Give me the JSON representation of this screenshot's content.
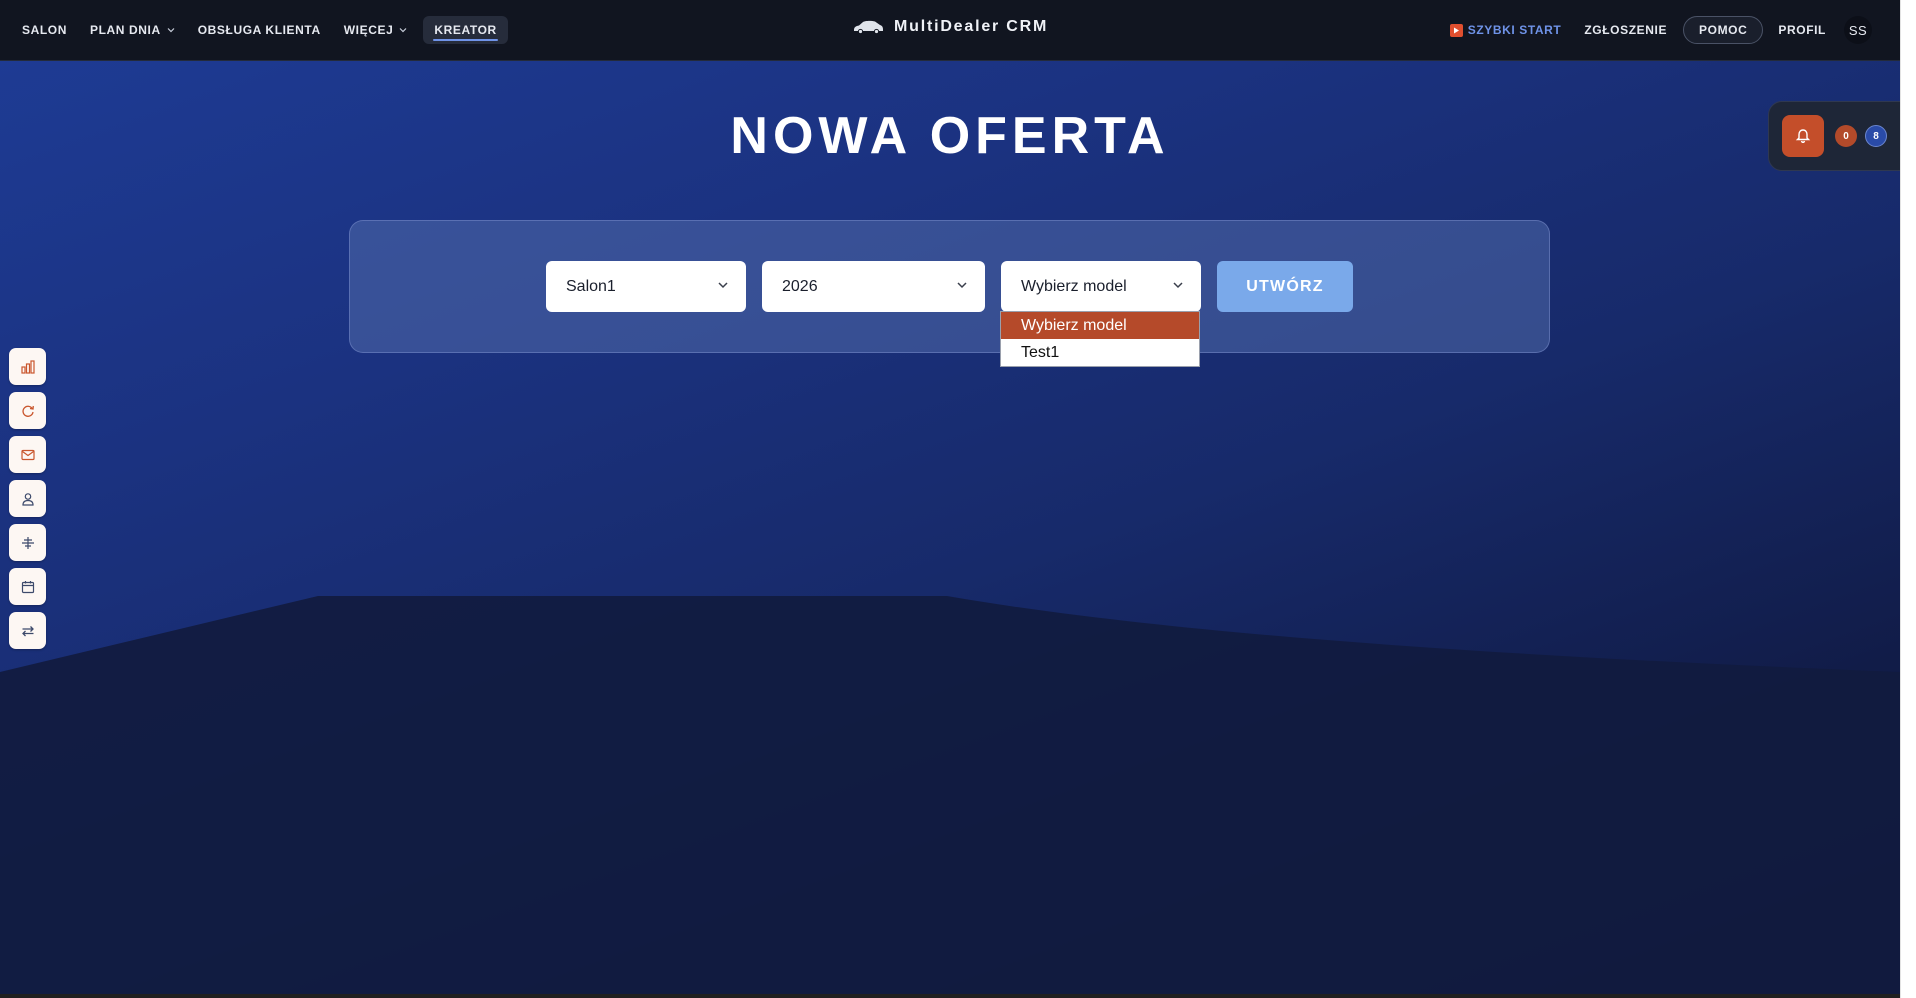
{
  "nav": {
    "left_items": [
      "SALON",
      "PLAN DNIA",
      "OBSŁUGA KLIENTA",
      "WIĘCEJ",
      "KREATOR"
    ],
    "active_item": "KREATOR",
    "brand": "MultiDealer CRM",
    "quick_start": "SZYBKI START",
    "report": "ZGŁOSZENIE",
    "help": "POMOC",
    "profile": "PROFIL",
    "avatar_initials": "SS"
  },
  "notifications": {
    "count_orange": "0",
    "count_blue": "8"
  },
  "page": {
    "title": "NOWA OFERTA"
  },
  "form": {
    "salon_value": "Salon1",
    "year_value": "2026",
    "model_value": "Wybierz model",
    "create_label": "UTWÓRZ",
    "model_options": [
      "Wybierz model",
      "Test1"
    ],
    "model_highlighted": "Wybierz model"
  },
  "sidebar_icons": [
    "chart-icon",
    "refresh-icon",
    "mail-icon",
    "user-icon",
    "tools-icon",
    "calendar-icon",
    "swap-icon"
  ],
  "colors": {
    "accent": "#b54a2a",
    "primary": "#7aa9ea",
    "nav_bg": "#111520"
  }
}
